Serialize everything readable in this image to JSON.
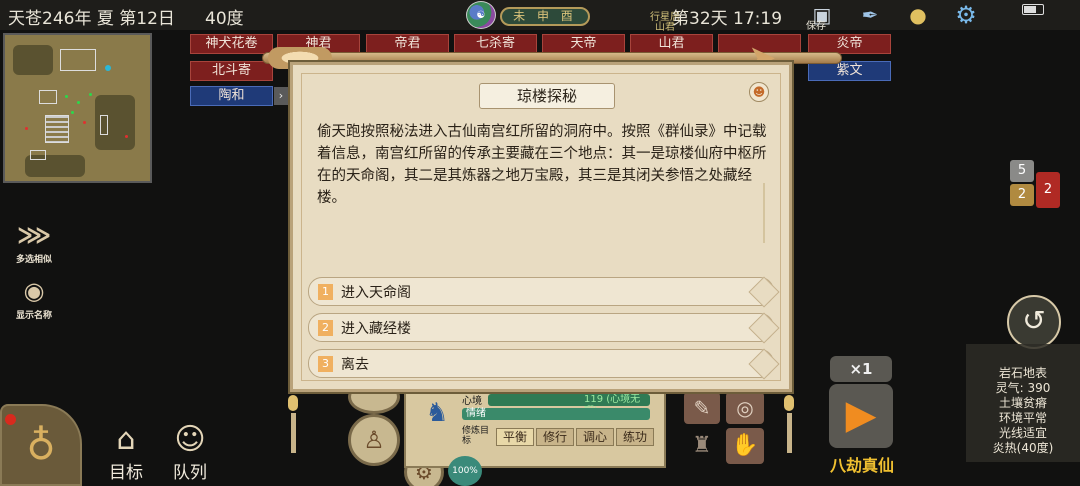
{
  "topbar": {
    "date": "天苍246年 夏 第12日",
    "temperature": "40度",
    "ganzhi": "未 申 酉",
    "xingqiu": "行星居",
    "shanjun": "山君",
    "day_time": "第32天 17:19",
    "save_label": "保存"
  },
  "deities": {
    "row1": [
      "神犬花卷",
      "神君",
      "帝君",
      "七杀寄",
      "天帝",
      "山君",
      "",
      "炎帝"
    ],
    "row2": [
      "北斗寄",
      "紫文"
    ],
    "row3": [
      "陶和"
    ]
  },
  "side_tools": {
    "multi_select": "多选相似",
    "show_names": "显示名称"
  },
  "bottom_tabs": {
    "target": "目标",
    "squad": "队列"
  },
  "stack_counts": {
    "top": "5",
    "left": "2",
    "right": "2"
  },
  "info_panel": {
    "lines": [
      "岩石地表",
      "灵气: 390",
      "土壤贫瘠",
      "环境平常",
      "光线适宜",
      "炎热(40度)"
    ]
  },
  "speed": "×1",
  "realm_label": "八劫真仙",
  "status_panel": {
    "xinjing_label": "心境",
    "xinjing_value": "119 (心境无暇)",
    "qingxu_label": "情绪",
    "modes_label": "修炼目标",
    "modes": [
      "平衡",
      "修行",
      "调心",
      "练功"
    ],
    "active_mode": 0,
    "percent": "100%"
  },
  "dialog": {
    "title": "琼楼探秘",
    "body": "偷天跑按照秘法进入古仙南宫红所留的洞府中。按照《群仙录》中记载着信息，南宫红所留的传承主要藏在三个地点：其一是琼楼仙府中枢所在的天命阁，其二是其炼器之地万宝殿，其三是其闭关参悟之处藏经楼。",
    "options": [
      {
        "num": "1",
        "label": "进入天命阁"
      },
      {
        "num": "2",
        "label": "进入藏经楼"
      },
      {
        "num": "3",
        "label": "离去"
      }
    ]
  },
  "colors": {
    "dialog_bg": "#e8dcc2",
    "deity_red": "#7d1f1e",
    "deity_blue": "#1f3a78",
    "realm_gold": "#f0c030",
    "play_orange": "#f08c20"
  }
}
